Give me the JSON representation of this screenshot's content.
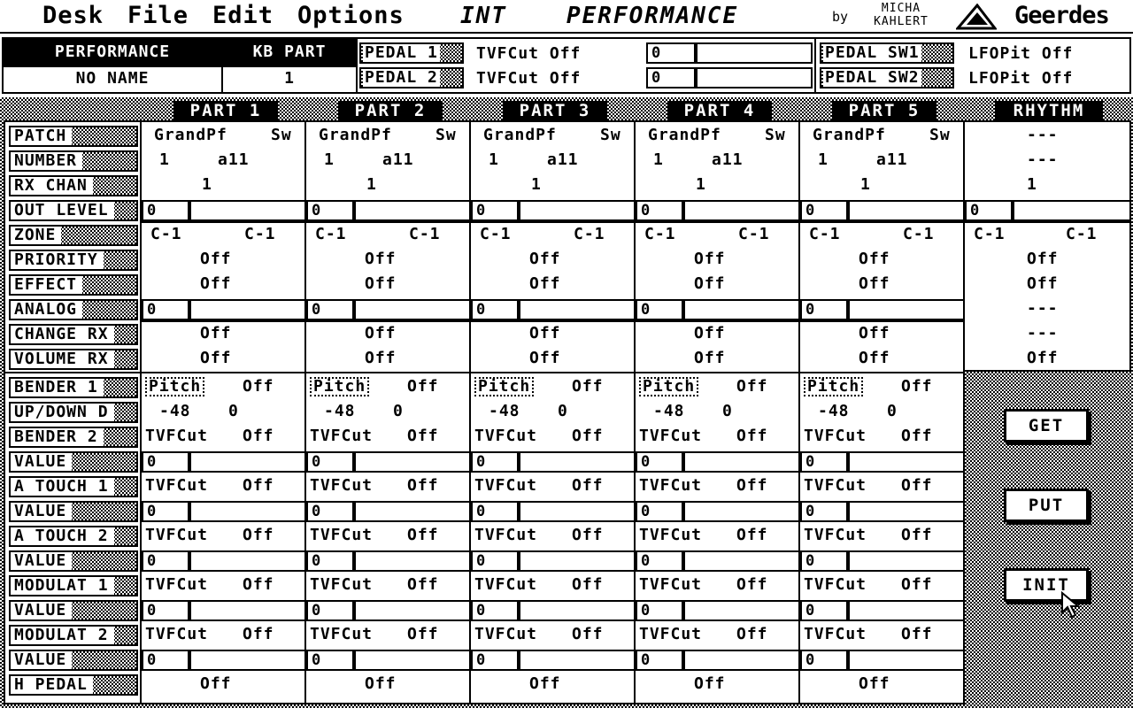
{
  "menu": {
    "desk": "Desk",
    "file": "File",
    "edit": "Edit",
    "options": "Options"
  },
  "title": {
    "left": "INT",
    "right": "PERFORMANCE"
  },
  "credits": {
    "by": "by",
    "author_first": "MICHA",
    "author_last": "KAHLERT",
    "brand": "Geerdes"
  },
  "header": {
    "performance_label": "PERFORMANCE",
    "performance_name": "NO NAME",
    "kb_part_label": "KB PART",
    "kb_part_value": "1",
    "pedal1_label": "PEDAL 1",
    "pedal1_value": "TVFCut Off",
    "pedal1_num": "0",
    "pedal2_label": "PEDAL 2",
    "pedal2_value": "TVFCut Off",
    "pedal2_num": "0",
    "pedal_sw1_label": "PEDAL SW1",
    "pedal_sw1_value": "LFOPit Off",
    "pedal_sw2_label": "PEDAL SW2",
    "pedal_sw2_value": "LFOPit Off"
  },
  "part_headers": [
    "PART 1",
    "PART 2",
    "PART 3",
    "PART 4",
    "PART 5",
    "RHYTHM"
  ],
  "row_labels": {
    "patch": "PATCH",
    "number": "NUMBER",
    "rx_chan": "RX CHAN",
    "out_level": "OUT LEVEL",
    "zone": "ZONE",
    "priority": "PRIORITY",
    "effect": "EFFECT",
    "analog": "ANALOG",
    "change_rx": "CHANGE RX",
    "volume_rx": "VOLUME RX",
    "bender1": "BENDER 1",
    "updown": "UP/DOWN D",
    "bender2": "BENDER 2",
    "value_b2": "VALUE",
    "atouch1": "A TOUCH 1",
    "value_at1": "VALUE",
    "atouch2": "A TOUCH 2",
    "value_at2": "VALUE",
    "modulat1": "MODULAT 1",
    "value_m1": "VALUE",
    "modulat2": "MODULAT 2",
    "value_m2": "VALUE",
    "hpedal": "H PEDAL"
  },
  "parts": {
    "patch_name": "GrandPf",
    "patch_sw": "Sw",
    "number_a": "1",
    "number_b": "a11",
    "rx_chan": "1",
    "level": "0",
    "zone_lo": "C-1",
    "zone_hi": "C-1",
    "off": "Off",
    "pitch": "Pitch",
    "updown_a": "-48",
    "updown_b": "0",
    "tvfcut": "TVFCut"
  },
  "rhythm": {
    "dash": "---",
    "rx_chan": "1",
    "level": "0",
    "zone_lo": "C-1",
    "zone_hi": "C-1",
    "off": "Off"
  },
  "buttons": {
    "get": "GET",
    "put": "PUT",
    "init": "INIT"
  }
}
